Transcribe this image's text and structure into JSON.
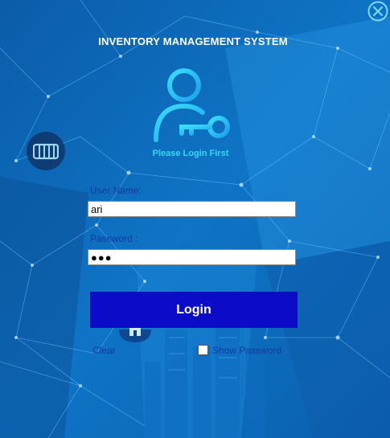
{
  "window": {
    "title": "INVENTORY MANAGEMENT SYSTEM",
    "subtitle": "Please Login First",
    "close_icon": "close-circle-icon"
  },
  "form": {
    "username_label": "User Name:",
    "username_value": "ari",
    "password_label": "Password :",
    "password_value": "●●●",
    "login_label": "Login",
    "clear_label": "Clear",
    "show_password_label": "Show Password",
    "show_password_checked": false
  },
  "decor": {
    "user_icon": "user-key-icon",
    "side_badge_icon": "warehouse-icon",
    "home_badge_icon": "home-icon"
  },
  "colors": {
    "background": "#0a63b5",
    "accent": "#33d9f4",
    "button": "#0c0cc8",
    "label_text": "#1238a0",
    "title_text": "#ffffff"
  }
}
